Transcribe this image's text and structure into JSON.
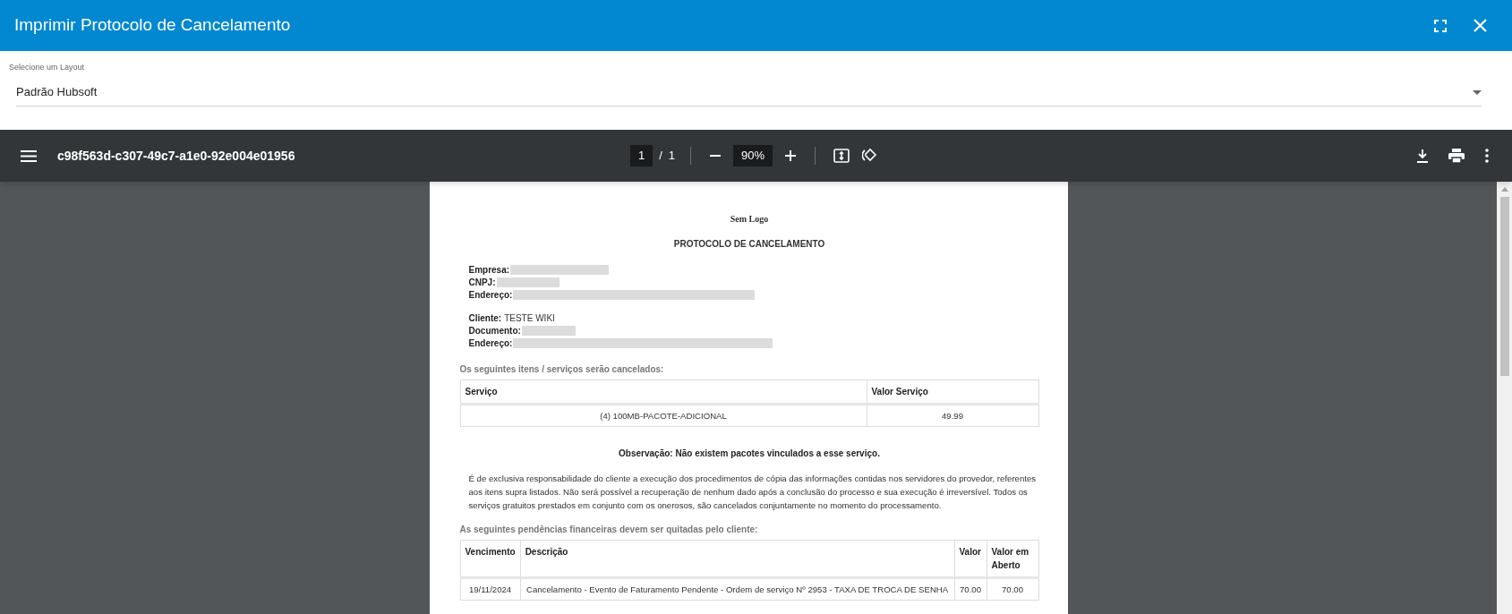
{
  "dialog": {
    "title": "Imprimir Protocolo de Cancelamento"
  },
  "layout_select": {
    "label": "Selecione um Layout",
    "value": "Padrão Hubsoft"
  },
  "viewer": {
    "filename": "c98f563d-c307-49c7-a1e0-92e004e01956",
    "page_current": "1",
    "page_separator": "/",
    "page_total": "1",
    "zoom": "90%"
  },
  "document": {
    "logo_text": "Sem Logo",
    "title": "PROTOCOLO DE CANCELAMENTO",
    "company_fields": [
      {
        "label": "Empresa:"
      },
      {
        "label": "CNPJ:"
      },
      {
        "label": "Endereço:"
      }
    ],
    "client_fields": [
      {
        "label": "Cliente:",
        "value": "TESTE WIKI"
      },
      {
        "label": "Documento:"
      },
      {
        "label": "Endereço:"
      }
    ],
    "services_heading": "Os seguintes itens / serviços serão cancelados:",
    "services_table": {
      "columns": [
        "Serviço",
        "Valor Serviço"
      ],
      "rows": [
        [
          "(4) 100MB-PACOTE-ADICIONAL",
          "49.99"
        ]
      ]
    },
    "observation": "Observação: Não existem pacotes vinculados a esse serviço.",
    "disclaimer": "É de exclusiva responsabilidade do cliente a execução dos procedimentos de cópia das informações contidas nos servidores do provedor, referentes aos itens supra listados. Não será possível a recuperação de nenhum dado após a conclusão do processo e sua execução é irreversível. Todos os serviços gratuitos prestados em conjunto com os onerosos, são cancelados conjuntamente no momento do processamento.",
    "pending_heading": "As seguintes pendências financeiras devem ser quitadas pelo cliente:",
    "pending_table": {
      "columns": [
        "Vencimento",
        "Descrição",
        "Valor",
        "Valor em Aberto"
      ],
      "rows": [
        [
          "19/11/2024",
          "Cancelamento - Evento de Faturamento Pendente - Ordem de serviço Nº 2953 - TAXA DE TROCA DE SENHA",
          "70.00",
          "70.00"
        ]
      ]
    }
  }
}
